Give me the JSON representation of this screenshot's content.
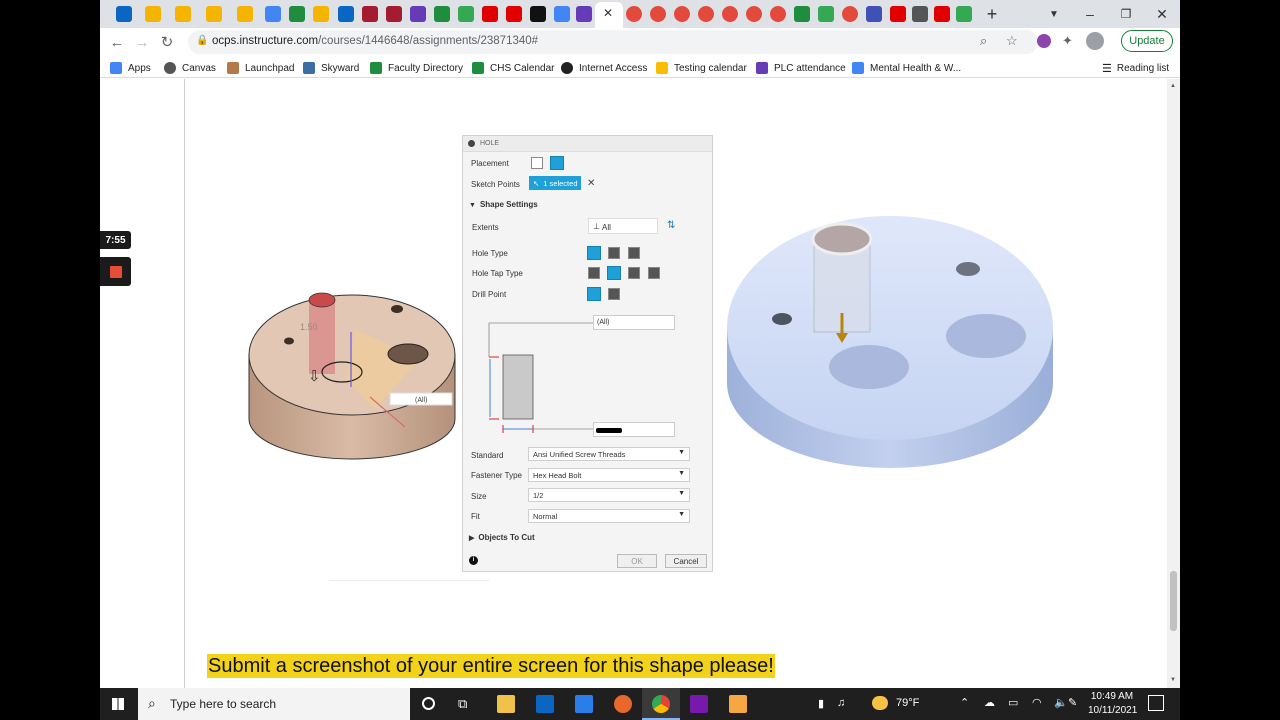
{
  "browser": {
    "url_host": "ocps.instructure.com",
    "url_path": "/courses/1446648/assignments/23871340#",
    "update_label": "Update",
    "bookmarks": [
      {
        "label": "Apps",
        "color": "#4285f4"
      },
      {
        "label": "Canvas",
        "color": "#555555"
      },
      {
        "label": "Launchpad",
        "color": "#b07a4a"
      },
      {
        "label": "Skyward",
        "color": "#3a6ea5"
      },
      {
        "label": "Faculty Directory",
        "color": "#1e8e3e"
      },
      {
        "label": "CHS Calendar",
        "color": "#1e8e3e"
      },
      {
        "label": "Internet Access",
        "color": "#222222"
      },
      {
        "label": "Testing calendar",
        "color": "#fbbc04"
      },
      {
        "label": "PLC attendance",
        "color": "#673ab7"
      },
      {
        "label": "Mental Health & W...",
        "color": "#4285f4"
      }
    ],
    "reading_list": "Reading list"
  },
  "overlay": {
    "timer": "7:55"
  },
  "hole_dialog": {
    "title": "HOLE",
    "placement_label": "Placement",
    "sketch_points_label": "Sketch Points",
    "sketch_points_value": "1 selected",
    "shape_settings_label": "Shape Settings",
    "extents_label": "Extents",
    "extents_value": "All",
    "hole_type_label": "Hole Type",
    "hole_tap_type_label": "Hole Tap Type",
    "drill_point_label": "Drill Point",
    "dim_top_value": "(All)",
    "standard_label": "Standard",
    "standard_value": "Ansi Unified Screw Threads",
    "fastener_type_label": "Fastener Type",
    "fastener_type_value": "Hex Head Bolt",
    "size_label": "Size",
    "size_value": "1/2",
    "fit_label": "Fit",
    "fit_value": "Normal",
    "objects_to_cut_label": "Objects To Cut",
    "ok_label": "OK",
    "cancel_label": "Cancel"
  },
  "model_left": {
    "dimension_label": "1.50",
    "extent_tag": "(All)"
  },
  "caption": "Submit a screenshot of your entire screen for this shape please!",
  "taskbar": {
    "search_placeholder": "Type here to search",
    "temperature": "79°F",
    "time": "10:49 AM",
    "date": "10/11/2021"
  }
}
